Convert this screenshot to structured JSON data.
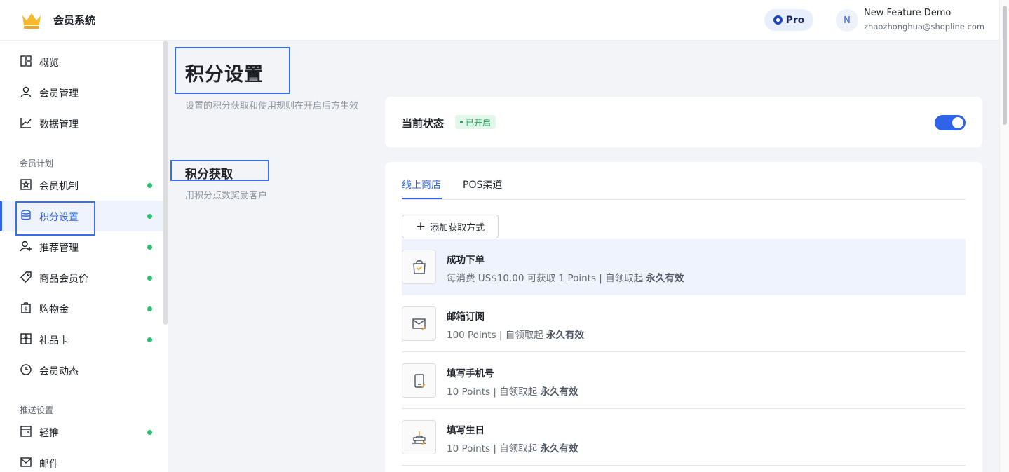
{
  "header": {
    "app_title": "会员系统",
    "plan_badge": "Pro",
    "avatar_initial": "N",
    "user_name": "New Feature Demo",
    "user_email": "zhaozhonghua@shopline.com"
  },
  "sidebar": {
    "items_top": [
      {
        "label": "概览",
        "icon": "overview-icon"
      },
      {
        "label": "会员管理",
        "icon": "user-icon"
      },
      {
        "label": "数据管理",
        "icon": "chart-icon"
      }
    ],
    "group1_title": "会员计划",
    "group1_items": [
      {
        "label": "会员机制",
        "icon": "tier-icon",
        "dot": true
      },
      {
        "label": "积分设置",
        "icon": "points-icon",
        "dot": true,
        "active": true
      },
      {
        "label": "推荐管理",
        "icon": "referral-icon",
        "dot": true
      },
      {
        "label": "商品会员价",
        "icon": "tag-icon",
        "dot": true
      },
      {
        "label": "购物金",
        "icon": "credit-icon",
        "dot": true
      },
      {
        "label": "礼品卡",
        "icon": "giftcard-icon",
        "dot": true
      },
      {
        "label": "会员动态",
        "icon": "clock-icon",
        "dot": false
      }
    ],
    "group2_title": "推送设置",
    "group2_items": [
      {
        "label": "轻推",
        "icon": "push-icon",
        "dot": true
      },
      {
        "label": "邮件",
        "icon": "mail-icon",
        "dot": false
      }
    ]
  },
  "page": {
    "title": "积分设置",
    "description": "设置的积分获取和使用规则在开启后方生效",
    "section_title": "积分获取",
    "section_description": "用积分点数奖励客户"
  },
  "status_card": {
    "label": "当前状态",
    "badge": "已开启",
    "toggle_on": true
  },
  "earn_card": {
    "tabs": [
      "线上商店",
      "POS渠道"
    ],
    "active_tab": 0,
    "add_button": "添加获取方式",
    "rules": [
      {
        "title": "成功下单",
        "desc": "每消费 US$10.00 可获取 1 Points | 自领取起",
        "validity": "永久有效",
        "icon": "bag-icon"
      },
      {
        "title": "邮箱订阅",
        "desc": "100 Points | 自领取起",
        "validity": "永久有效",
        "icon": "envelope-icon"
      },
      {
        "title": "填写手机号",
        "desc": "10 Points | 自领取起",
        "validity": "永久有效",
        "icon": "phone-icon"
      },
      {
        "title": "填写生日",
        "desc": "10 Points | 自领取起",
        "validity": "永久有效",
        "icon": "cake-icon"
      }
    ]
  },
  "colors": {
    "accent": "#2f64e8",
    "status_green": "#2fbf71",
    "highlight_border": "#3a6ee8"
  }
}
